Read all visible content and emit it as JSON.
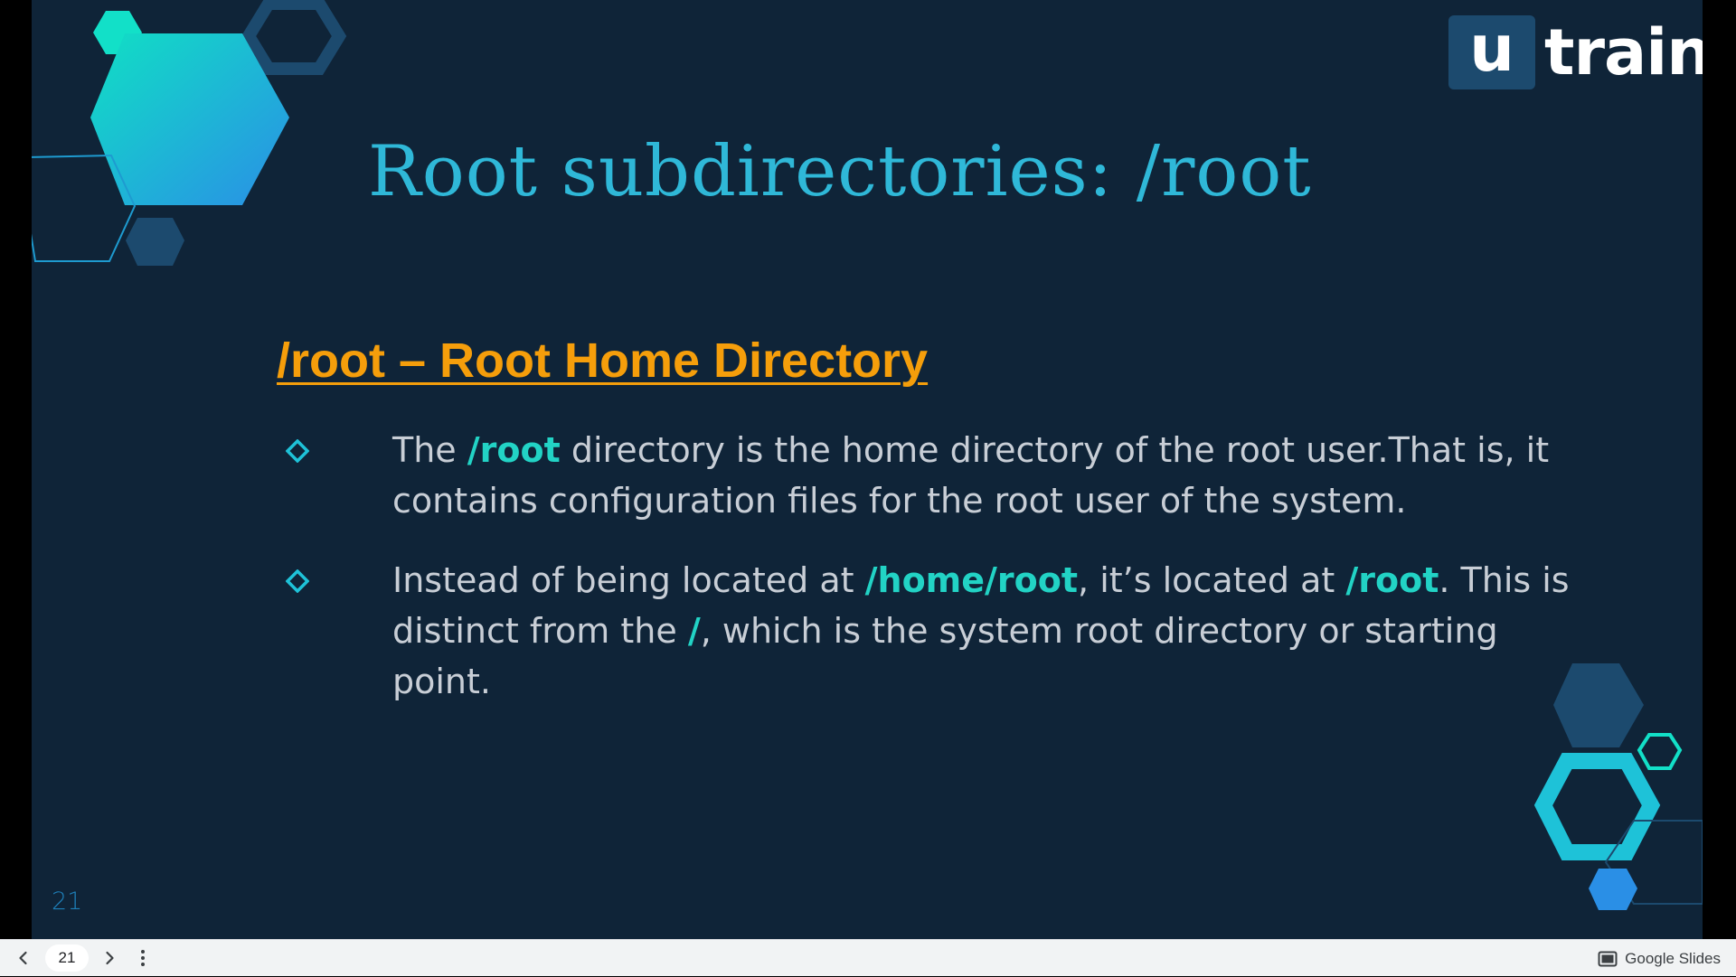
{
  "slide": {
    "logo": {
      "box_letter": "u",
      "word": "train"
    },
    "title": "Root subdirectories: /root",
    "heading": "/root – Root Home Directory",
    "bullets": [
      {
        "parts": [
          {
            "text": "The ",
            "highlight": false
          },
          {
            "text": "/root",
            "highlight": true
          },
          {
            "text": " directory is the home directory of the root user.That is, it contains configuration files for the root user of the system.",
            "highlight": false
          }
        ]
      },
      {
        "parts": [
          {
            "text": "Instead of being located at ",
            "highlight": false
          },
          {
            "text": "/home/root",
            "highlight": true
          },
          {
            "text": ", it’s located at ",
            "highlight": false
          },
          {
            "text": "/root",
            "highlight": true
          },
          {
            "text": ". This is distinct from the ",
            "highlight": false
          },
          {
            "text": "/",
            "highlight": true
          },
          {
            "text": ", which is the system root directory or starting point.",
            "highlight": false
          }
        ]
      }
    ],
    "page_number": "21",
    "colors": {
      "background": "#0f2438",
      "title": "#2fb8d8",
      "heading": "#f59e0b",
      "highlight": "#22d3c5",
      "body_text": "#c8ced6",
      "accent_teal": "#12e0c8",
      "accent_blue": "#1c4a6e"
    }
  },
  "toolbar": {
    "prev_icon": "chevron-left-icon",
    "current_page": "21",
    "next_icon": "chevron-right-icon",
    "menu_icon": "more-vert-icon",
    "brand_icon": "slides-icon",
    "brand_label": "Google Slides"
  }
}
